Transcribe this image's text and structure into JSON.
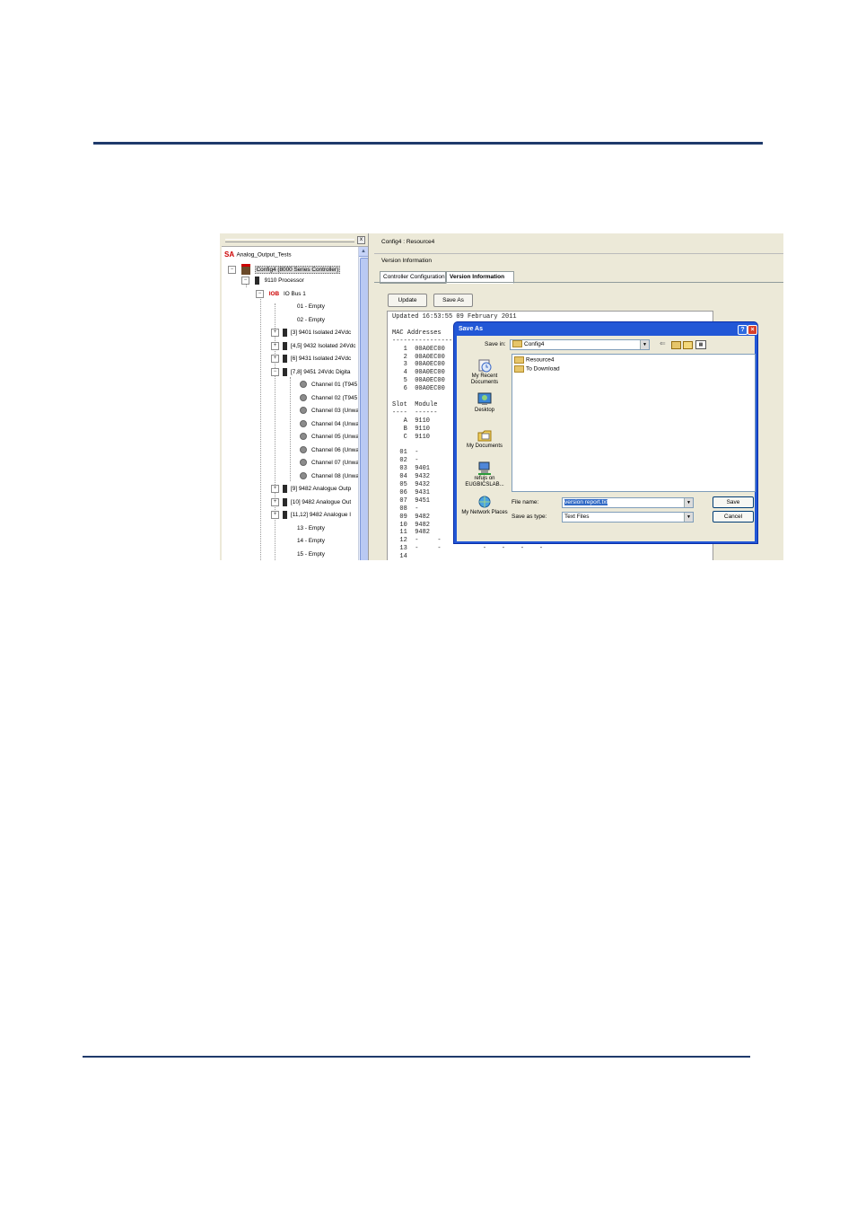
{
  "tree": {
    "items": [
      {
        "label": "Analog_Output_Tests"
      },
      {
        "label": "Config4 (8000 Series Controller)"
      },
      {
        "label": "9110 Processor"
      },
      {
        "label": "IO Bus 1",
        "tag": "IOB"
      },
      {
        "label": "01 - Empty"
      },
      {
        "label": "02 - Empty"
      },
      {
        "label": "[3] 9401 Isolated 24Vdc"
      },
      {
        "label": "[4,5] 9432 Isolated 24Vdc"
      },
      {
        "label": "[6] 9431 Isolated 24Vdc"
      },
      {
        "label": "[7,8] 9451 24Vdc Digita"
      },
      {
        "label": "Channel 01 (T945"
      },
      {
        "label": "Channel 02 (T945"
      },
      {
        "label": "Channel 03 (Unwa"
      },
      {
        "label": "Channel 04 (Unwa"
      },
      {
        "label": "Channel 05 (Unwa"
      },
      {
        "label": "Channel 06 (Unwa"
      },
      {
        "label": "Channel 07 (Unwa"
      },
      {
        "label": "Channel 08 (Unwa"
      },
      {
        "label": "[9] 9482 Analogue Outp"
      },
      {
        "label": "[10] 9482 Analogue Out"
      },
      {
        "label": "[11,12] 9482 Analogue I"
      },
      {
        "label": "13 - Empty"
      },
      {
        "label": "14 - Empty"
      },
      {
        "label": "15 - Empty"
      }
    ]
  },
  "panel": {
    "header": "Config4 : Resource4",
    "subheader": "Version Information",
    "tabs": [
      "Controller Configuration",
      "Version Information"
    ],
    "update_label": "Update",
    "saveas_label": "Save As",
    "report": "Updated 16:53:55 09 February 2011\n\nMAC Addresses\n-------------------------------------------------------\n   1  00A0EC00\n   2  00A0EC00\n   3  00A0EC00\n   4  00A0EC00\n   5  00A0EC00\n   6  00A0EC00\n\nSlot  Module\n----  ------\n   A  9110\n   B  9110\n   C  9110\n\n  01  -\n  02  -\n  03  9401\n  04  9432\n  05  9432\n  06  9431\n  07  9451\n  08  -\n  09  9482\n  10  9482\n  11  9482\n  12  -     -           -    -    -    -\n  13  -     -           -    -    -    -\n  14"
  },
  "dialog": {
    "title": "Save As",
    "save_in_label": "Save in:",
    "save_in_value": "Config4",
    "places": [
      "My Recent Documents",
      "Desktop",
      "My Documents",
      "refujs on EUGBICSLAB...",
      "My Network Places"
    ],
    "files": [
      "Resource4",
      "To Download"
    ],
    "file_name_label": "File name:",
    "file_name_value": "version report.txt",
    "save_type_label": "Save as type:",
    "save_type_value": "Text Files",
    "save_label": "Save",
    "cancel_label": "Cancel",
    "help_glyph": "?",
    "close_glyph": "×"
  }
}
